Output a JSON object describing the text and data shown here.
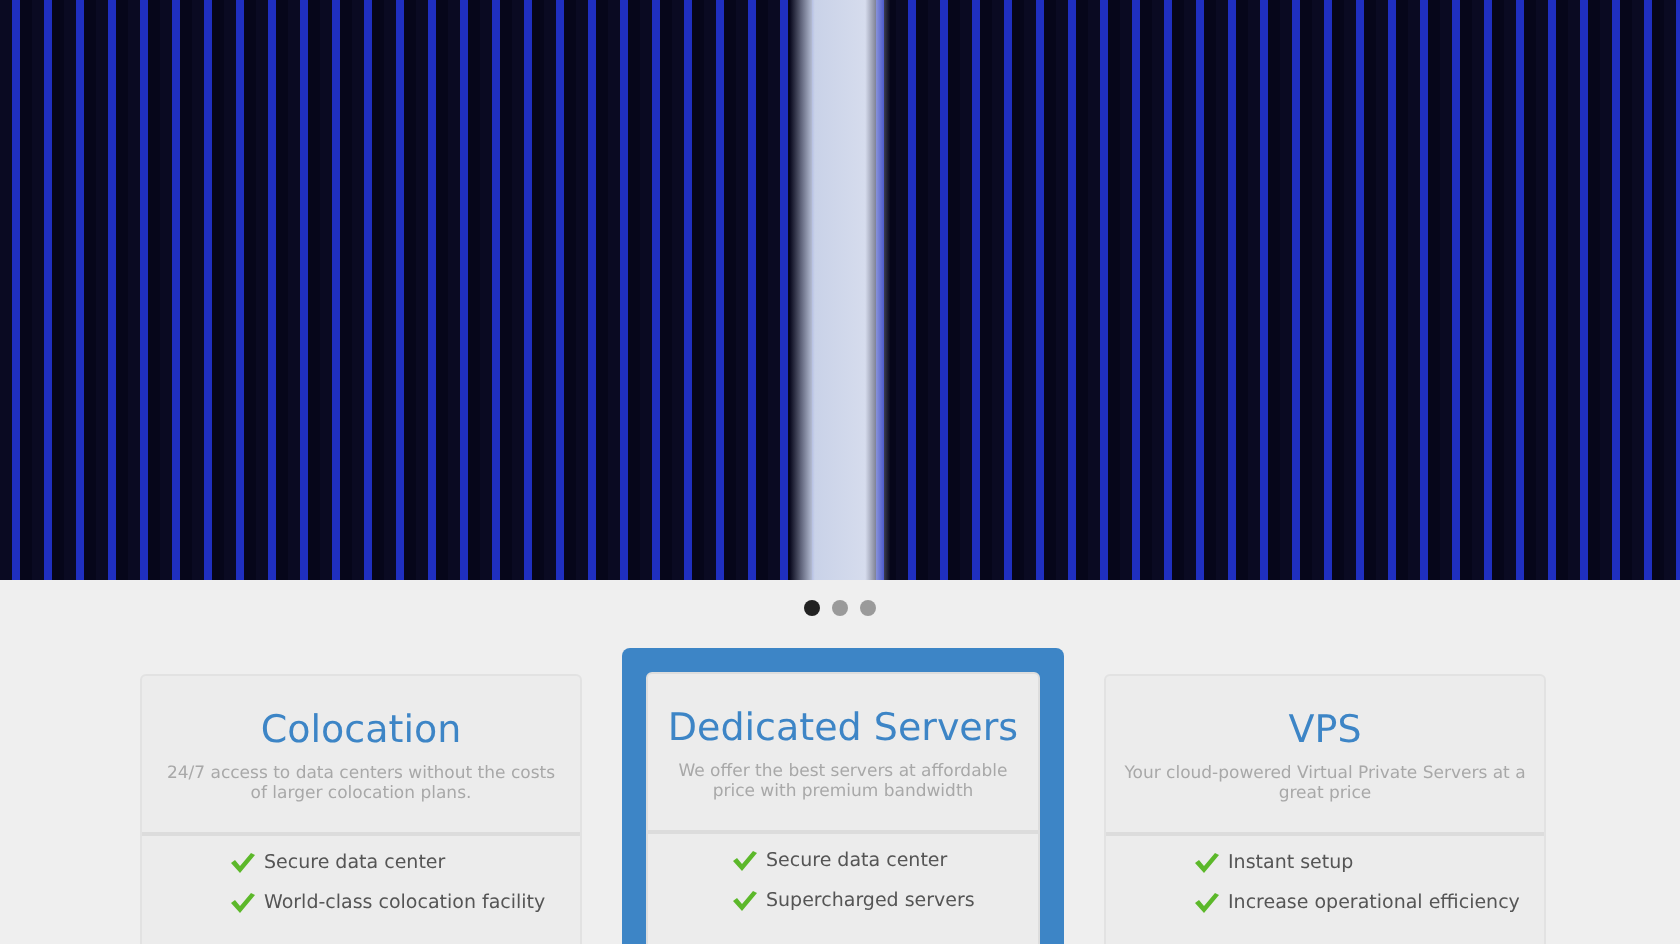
{
  "hero": {
    "slides": [
      {
        "selected": true
      },
      {
        "selected": false
      },
      {
        "selected": false
      }
    ]
  },
  "plans": [
    {
      "title": "Colocation",
      "description": "24/7 access to data centers without the costs of larger colocation plans.",
      "featured": false,
      "features": [
        "Secure data center",
        "World-class colocation facility"
      ]
    },
    {
      "title": "Dedicated Servers",
      "description": "We offer the best servers at affordable price with premium bandwidth",
      "featured": true,
      "features": [
        "Secure data center",
        "Supercharged servers"
      ]
    },
    {
      "title": "VPS",
      "description": "Your cloud-powered Virtual Private Servers at a great price",
      "featured": false,
      "features": [
        "Instant setup",
        "Increase operational efficiency"
      ]
    }
  ]
}
